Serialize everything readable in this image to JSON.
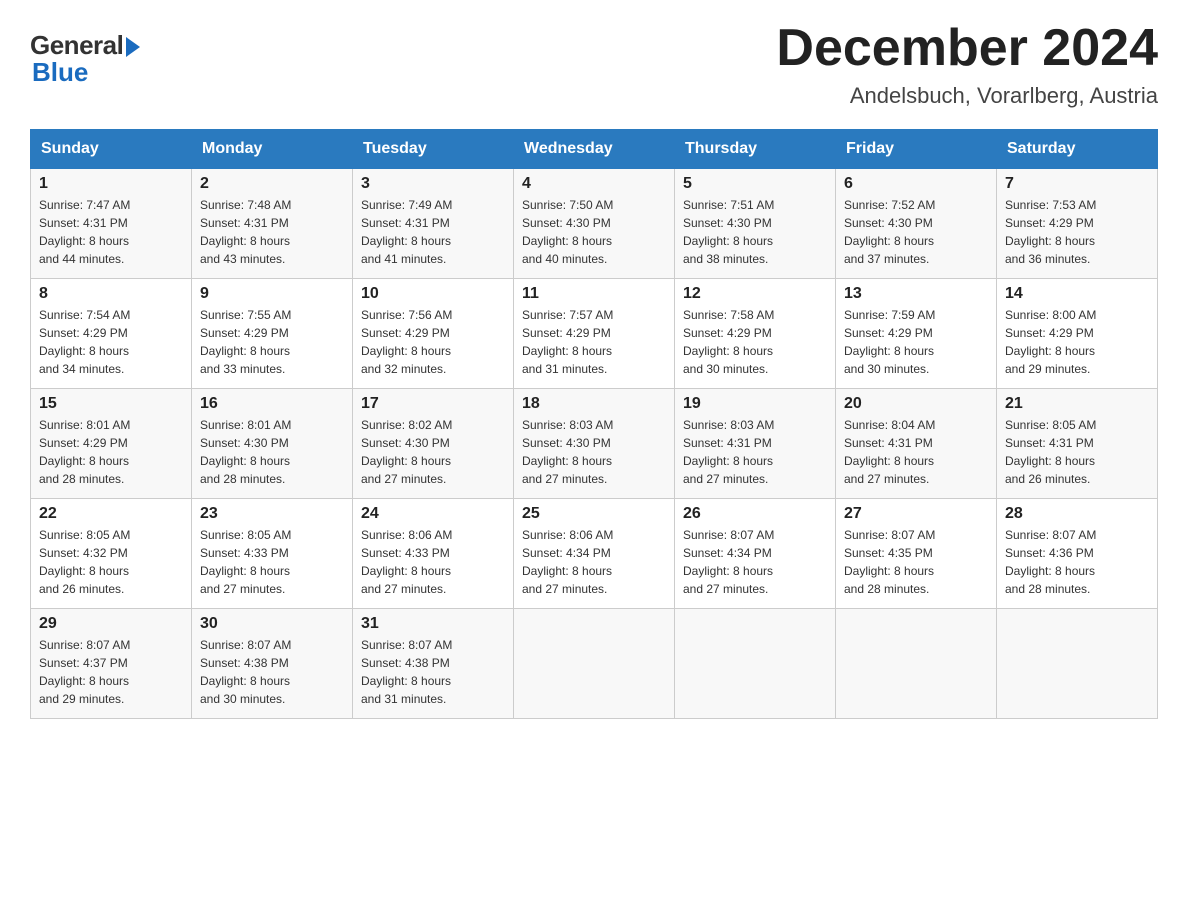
{
  "header": {
    "logo_general": "General",
    "logo_blue": "Blue",
    "month_title": "December 2024",
    "subtitle": "Andelsbuch, Vorarlberg, Austria"
  },
  "days_of_week": [
    "Sunday",
    "Monday",
    "Tuesday",
    "Wednesday",
    "Thursday",
    "Friday",
    "Saturday"
  ],
  "weeks": [
    [
      {
        "day": "1",
        "info": "Sunrise: 7:47 AM\nSunset: 4:31 PM\nDaylight: 8 hours\nand 44 minutes."
      },
      {
        "day": "2",
        "info": "Sunrise: 7:48 AM\nSunset: 4:31 PM\nDaylight: 8 hours\nand 43 minutes."
      },
      {
        "day": "3",
        "info": "Sunrise: 7:49 AM\nSunset: 4:31 PM\nDaylight: 8 hours\nand 41 minutes."
      },
      {
        "day": "4",
        "info": "Sunrise: 7:50 AM\nSunset: 4:30 PM\nDaylight: 8 hours\nand 40 minutes."
      },
      {
        "day": "5",
        "info": "Sunrise: 7:51 AM\nSunset: 4:30 PM\nDaylight: 8 hours\nand 38 minutes."
      },
      {
        "day": "6",
        "info": "Sunrise: 7:52 AM\nSunset: 4:30 PM\nDaylight: 8 hours\nand 37 minutes."
      },
      {
        "day": "7",
        "info": "Sunrise: 7:53 AM\nSunset: 4:29 PM\nDaylight: 8 hours\nand 36 minutes."
      }
    ],
    [
      {
        "day": "8",
        "info": "Sunrise: 7:54 AM\nSunset: 4:29 PM\nDaylight: 8 hours\nand 34 minutes."
      },
      {
        "day": "9",
        "info": "Sunrise: 7:55 AM\nSunset: 4:29 PM\nDaylight: 8 hours\nand 33 minutes."
      },
      {
        "day": "10",
        "info": "Sunrise: 7:56 AM\nSunset: 4:29 PM\nDaylight: 8 hours\nand 32 minutes."
      },
      {
        "day": "11",
        "info": "Sunrise: 7:57 AM\nSunset: 4:29 PM\nDaylight: 8 hours\nand 31 minutes."
      },
      {
        "day": "12",
        "info": "Sunrise: 7:58 AM\nSunset: 4:29 PM\nDaylight: 8 hours\nand 30 minutes."
      },
      {
        "day": "13",
        "info": "Sunrise: 7:59 AM\nSunset: 4:29 PM\nDaylight: 8 hours\nand 30 minutes."
      },
      {
        "day": "14",
        "info": "Sunrise: 8:00 AM\nSunset: 4:29 PM\nDaylight: 8 hours\nand 29 minutes."
      }
    ],
    [
      {
        "day": "15",
        "info": "Sunrise: 8:01 AM\nSunset: 4:29 PM\nDaylight: 8 hours\nand 28 minutes."
      },
      {
        "day": "16",
        "info": "Sunrise: 8:01 AM\nSunset: 4:30 PM\nDaylight: 8 hours\nand 28 minutes."
      },
      {
        "day": "17",
        "info": "Sunrise: 8:02 AM\nSunset: 4:30 PM\nDaylight: 8 hours\nand 27 minutes."
      },
      {
        "day": "18",
        "info": "Sunrise: 8:03 AM\nSunset: 4:30 PM\nDaylight: 8 hours\nand 27 minutes."
      },
      {
        "day": "19",
        "info": "Sunrise: 8:03 AM\nSunset: 4:31 PM\nDaylight: 8 hours\nand 27 minutes."
      },
      {
        "day": "20",
        "info": "Sunrise: 8:04 AM\nSunset: 4:31 PM\nDaylight: 8 hours\nand 27 minutes."
      },
      {
        "day": "21",
        "info": "Sunrise: 8:05 AM\nSunset: 4:31 PM\nDaylight: 8 hours\nand 26 minutes."
      }
    ],
    [
      {
        "day": "22",
        "info": "Sunrise: 8:05 AM\nSunset: 4:32 PM\nDaylight: 8 hours\nand 26 minutes."
      },
      {
        "day": "23",
        "info": "Sunrise: 8:05 AM\nSunset: 4:33 PM\nDaylight: 8 hours\nand 27 minutes."
      },
      {
        "day": "24",
        "info": "Sunrise: 8:06 AM\nSunset: 4:33 PM\nDaylight: 8 hours\nand 27 minutes."
      },
      {
        "day": "25",
        "info": "Sunrise: 8:06 AM\nSunset: 4:34 PM\nDaylight: 8 hours\nand 27 minutes."
      },
      {
        "day": "26",
        "info": "Sunrise: 8:07 AM\nSunset: 4:34 PM\nDaylight: 8 hours\nand 27 minutes."
      },
      {
        "day": "27",
        "info": "Sunrise: 8:07 AM\nSunset: 4:35 PM\nDaylight: 8 hours\nand 28 minutes."
      },
      {
        "day": "28",
        "info": "Sunrise: 8:07 AM\nSunset: 4:36 PM\nDaylight: 8 hours\nand 28 minutes."
      }
    ],
    [
      {
        "day": "29",
        "info": "Sunrise: 8:07 AM\nSunset: 4:37 PM\nDaylight: 8 hours\nand 29 minutes."
      },
      {
        "day": "30",
        "info": "Sunrise: 8:07 AM\nSunset: 4:38 PM\nDaylight: 8 hours\nand 30 minutes."
      },
      {
        "day": "31",
        "info": "Sunrise: 8:07 AM\nSunset: 4:38 PM\nDaylight: 8 hours\nand 31 minutes."
      },
      null,
      null,
      null,
      null
    ]
  ]
}
